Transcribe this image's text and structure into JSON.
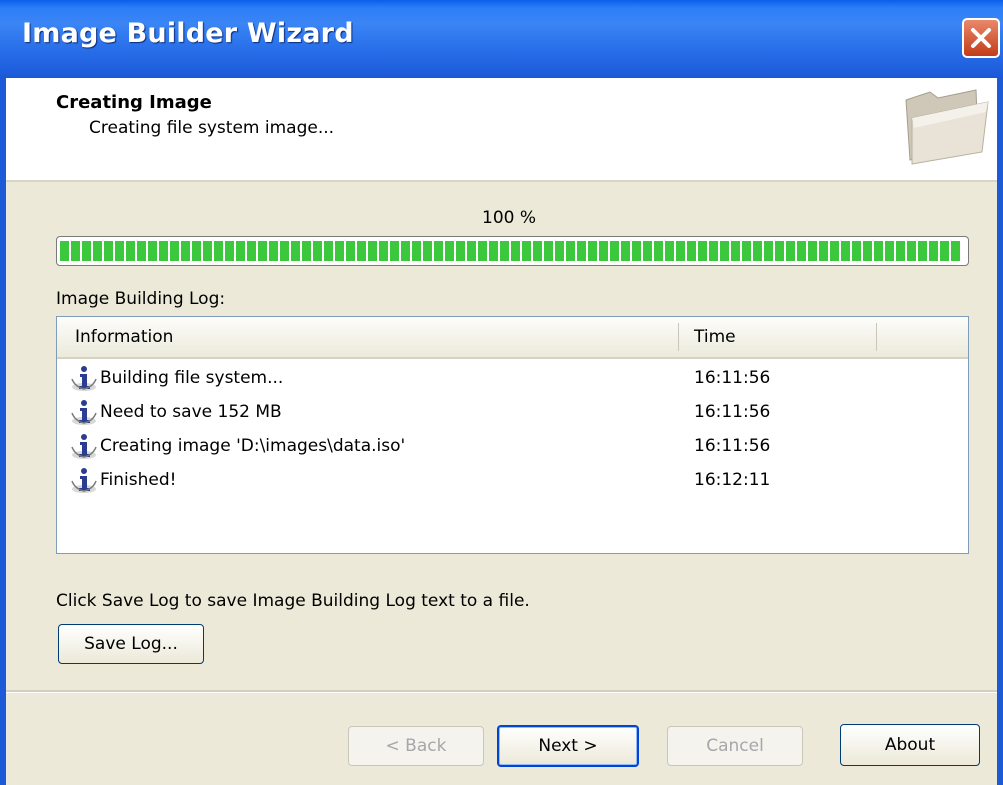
{
  "window": {
    "title": "Image Builder Wizard"
  },
  "header": {
    "title": "Creating Image",
    "subtitle": "Creating file system image..."
  },
  "progress": {
    "label": "100 %",
    "value": 1.0
  },
  "log": {
    "label": "Image Building Log:",
    "columns": {
      "information": "Information",
      "time": "Time"
    },
    "rows": [
      {
        "icon": "info-icon",
        "message": "Building file system...",
        "time": "16:11:56"
      },
      {
        "icon": "info-icon",
        "message": "Need to save 152 MB",
        "time": "16:11:56"
      },
      {
        "icon": "info-icon",
        "message": "Creating image 'D:\\images\\data.iso'",
        "time": "16:11:56"
      },
      {
        "icon": "info-icon",
        "message": "Finished!",
        "time": "16:12:11"
      }
    ]
  },
  "hint": "Click Save Log to save Image Building Log text to a file.",
  "buttons": {
    "save_log": "Save Log...",
    "back": "< Back",
    "next": "Next >",
    "cancel": "Cancel",
    "about": "About"
  },
  "colors": {
    "title_bar": "#2a71ea",
    "progress_green": "#3cc83c",
    "dialog_bg": "#ece9d8"
  }
}
